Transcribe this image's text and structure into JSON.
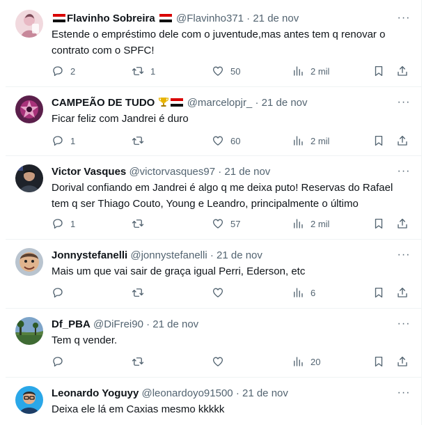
{
  "tweets": [
    {
      "name": "Flavinho Sobreira",
      "handle": "@Flavinho371",
      "date": "21 de nov",
      "text_lines": [
        "Estende o empréstimo dele com o juventude,mas antes tem q renovar o",
        "contrato com o SPFC!"
      ],
      "replies": "2",
      "retweets": "1",
      "likes": "50",
      "views": "2 mil",
      "avatar": "avatar-illustration"
    },
    {
      "name": "CAMPEÃO DE TUDO",
      "handle": "@marcelopjr_",
      "date": "21 de nov",
      "text_lines": [
        "Ficar feliz com Jandrei é duro"
      ],
      "replies": "1",
      "retweets": "",
      "likes": "60",
      "views": "2 mil",
      "avatar": "avatar-purple-emblem"
    },
    {
      "name": "Victor Vasques",
      "handle": "@victorvasques97",
      "date": "21 de nov",
      "text_lines": [
        "Dorival confiando em Jandrei é algo q me deixa puto! Reservas do Rafael",
        "tem q ser Thiago Couto, Young e Leandro, principalmente o último"
      ],
      "replies": "1",
      "retweets": "",
      "likes": "57",
      "views": "2 mil",
      "avatar": "avatar-dark-photo"
    },
    {
      "name": "Jonnystefanelli",
      "handle": "@jonnystefanelli",
      "date": "21 de nov",
      "text_lines": [
        "Mais um que vai sair de graça igual Perri, Ederson, etc"
      ],
      "replies": "",
      "retweets": "",
      "likes": "",
      "views": "6",
      "avatar": "avatar-cartoon-face"
    },
    {
      "name": "Df_PBA",
      "handle": "@DiFrei90",
      "date": "21 de nov",
      "text_lines": [
        "Tem q vender."
      ],
      "replies": "",
      "retweets": "",
      "likes": "",
      "views": "20",
      "avatar": "avatar-landscape"
    },
    {
      "name": "Leonardo Yoguyy",
      "handle": "@leonardoyo91500",
      "date": "21 de nov",
      "text_lines": [
        "Deixa ele lá em Caxias mesmo kkkkk"
      ],
      "replies": "",
      "retweets": "",
      "likes": "",
      "views": "",
      "avatar": "avatar-man-glasses"
    }
  ],
  "separator": "·",
  "more_glyph": "···"
}
